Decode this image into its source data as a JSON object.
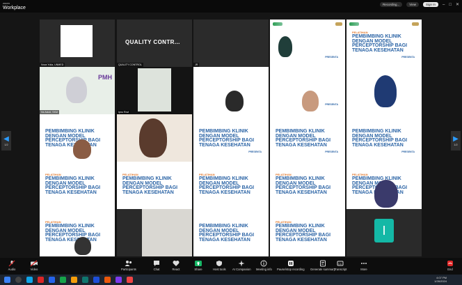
{
  "app": {
    "brand_small": "zoom",
    "brand": "Workplace"
  },
  "titlebar": {
    "recording": "Recording...",
    "view": "View",
    "sign_in": "Sign In"
  },
  "nav": {
    "page_left": "1/2",
    "page_right": "1/2"
  },
  "slide": {
    "kicker": "PELATIHAN",
    "title": "PEMBIMBING KLINIK DENGAN MODEL PERCEPTORSHIP BAGI TENAGA KESEHATAN",
    "presenter": "PRESENTA"
  },
  "quality_tile": {
    "text": "QUALITY CONTR..."
  },
  "i_tile": {
    "letter": "I"
  },
  "tiles": [
    {
      "name": "Nova Yulia, UNMED"
    },
    {
      "name": "QUALITY CONTROL"
    },
    {
      "name": "JR"
    },
    {
      "name": ""
    },
    {
      "name": ""
    },
    {
      "name": "Ns Astuti, SKM"
    },
    {
      "name": "Ipnu Rovi"
    },
    {
      "name": ""
    },
    {
      "name": ""
    },
    {
      "name": ""
    },
    {
      "name": ""
    },
    {
      "name": ""
    },
    {
      "name": ""
    },
    {
      "name": ""
    },
    {
      "name": ""
    },
    {
      "name": ""
    },
    {
      "name": ""
    },
    {
      "name": ""
    },
    {
      "name": ""
    },
    {
      "name": ""
    },
    {
      "name": ""
    },
    {
      "name": ""
    },
    {
      "name": ""
    },
    {
      "name": ""
    },
    {
      "name": ""
    },
    {
      "name": ""
    },
    {
      "name": ""
    },
    {
      "name": ""
    }
  ],
  "toolbar": {
    "audio": "Audio",
    "video": "Video",
    "participants": "Participants",
    "participants_count": "27",
    "chat": "Chat",
    "react": "React",
    "share": "Share",
    "host_tools": "Host tools",
    "ai_companion": "AI Companion",
    "meeting_info": "Meeting info",
    "pause_recording": "Pause/stop recording",
    "summary": "Generate summary",
    "transcript": "Transcript",
    "more": "More",
    "end": "End"
  },
  "taskbar": {
    "time": "4:07 PM",
    "date": "1/26/2024"
  },
  "colors": {
    "accent": "#2b9cff",
    "end": "#e02828",
    "teal": "#14b8a6"
  }
}
